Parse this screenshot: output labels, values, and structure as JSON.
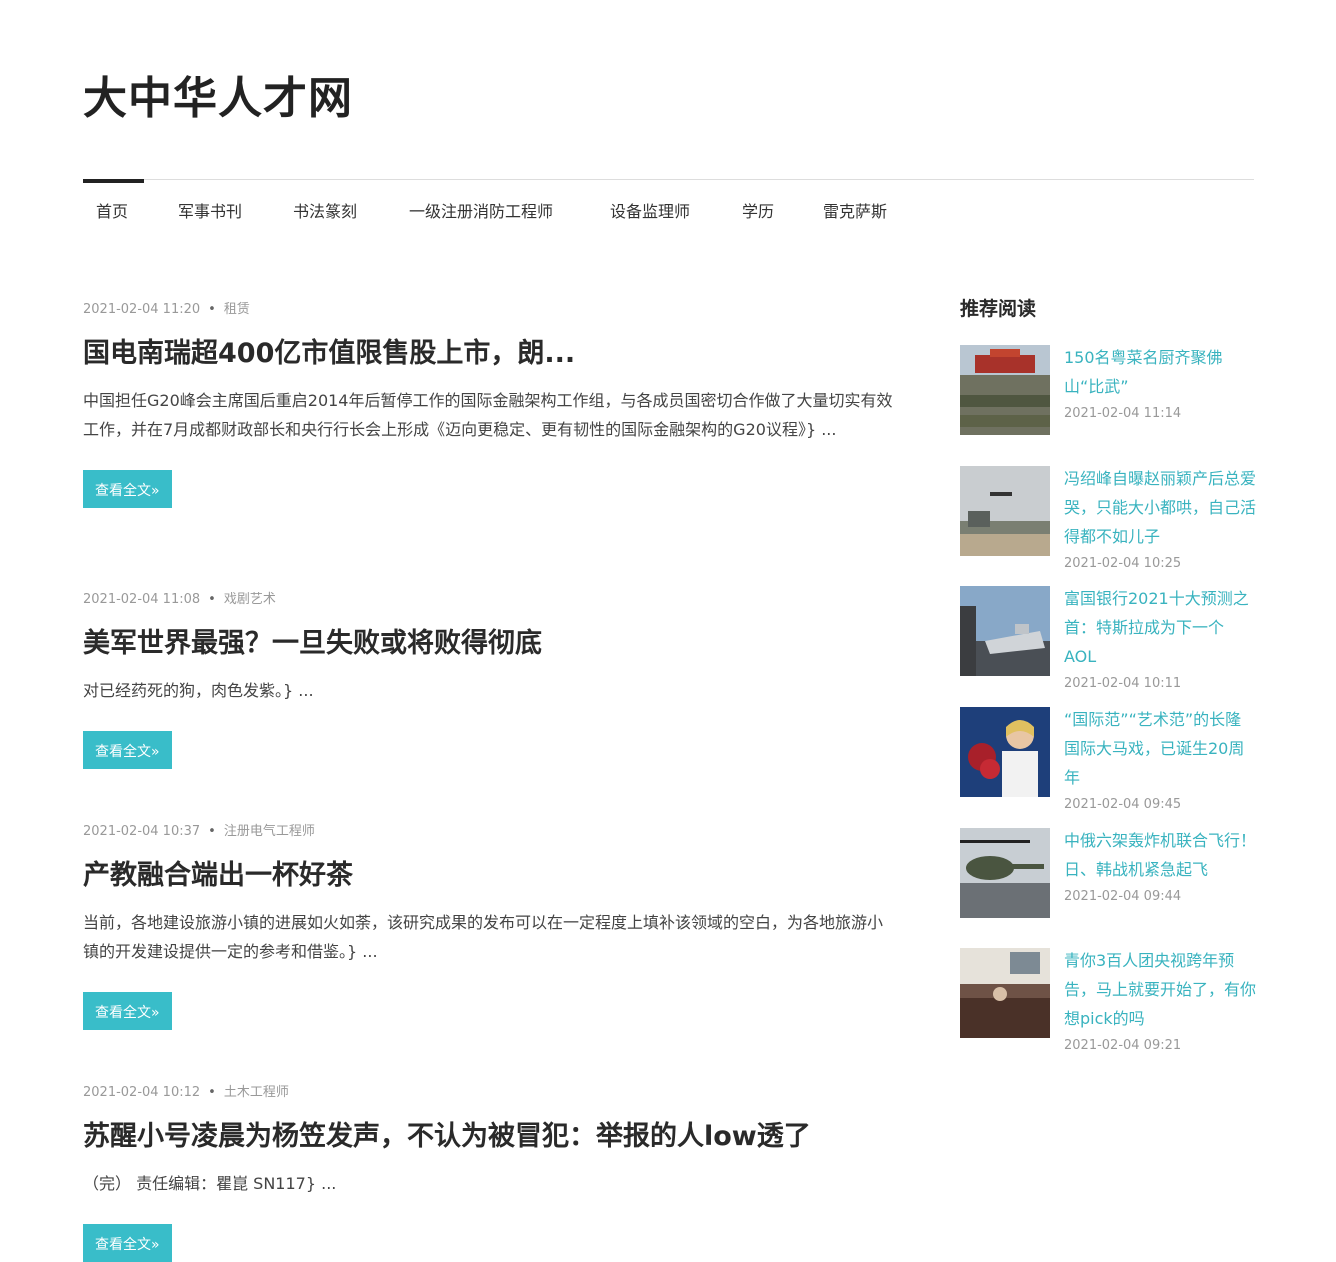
{
  "site": {
    "title": "大中华人才网"
  },
  "nav": {
    "items": [
      {
        "label": "首页"
      },
      {
        "label": "军事书刊"
      },
      {
        "label": "书法篆刻"
      },
      {
        "label": "一级注册消防工程师"
      },
      {
        "label": "设备监理师"
      },
      {
        "label": "学历"
      },
      {
        "label": "雷克萨斯"
      }
    ]
  },
  "posts": [
    {
      "date": "2021-02-04 11:20",
      "category": "租赁",
      "title": "国电南瑞超400亿市值限售股上市，朗...",
      "excerpt": "中国担任G20峰会主席国后重启2014年后暂停工作的国际金融架构工作组，与各成员国密切合作做了大量切实有效工作，并在7月成都财政部长和央行行长会上形成《迈向更稳定、更有韧性的国际金融架构的G20议程》} ...",
      "button": "查看全文»"
    },
    {
      "date": "2021-02-04 11:08",
      "category": "戏剧艺术",
      "title": "美军世界最强？一旦失败或将败得彻底",
      "excerpt": "对已经药死的狗，肉色发紫。} ...",
      "button": "查看全文»"
    },
    {
      "date": "2021-02-04 10:37",
      "category": "注册电气工程师",
      "title": "产教融合端出一杯好茶",
      "excerpt": "当前，各地建设旅游小镇的进展如火如荼，该研究成果的发布可以在一定程度上填补该领域的空白，为各地旅游小镇的开发建设提供一定的参考和借鉴。} ...",
      "button": "查看全文»"
    },
    {
      "date": "2021-02-04 10:12",
      "category": "土木工程师",
      "title": "苏醒小号凌晨为杨笠发声，不认为被冒犯：举报的人low透了",
      "excerpt": "（完） 责任编辑：瞿崑 SN117} ...",
      "button": "查看全文»"
    }
  ],
  "sidebar": {
    "title": "推荐阅读",
    "items": [
      {
        "title": "150名粤菜名厨齐聚佛山“比武”",
        "date": "2021-02-04 11:14",
        "thumb": "parade-image"
      },
      {
        "title": "冯绍峰自曝赵丽颖产后总爱哭，只能大小都哄，自己活得都不如儿子",
        "date": "2021-02-04 10:25",
        "thumb": "drone-image"
      },
      {
        "title": "富国银行2021十大预测之首：特斯拉成为下一个AOL",
        "date": "2021-02-04 10:11",
        "thumb": "warship-image"
      },
      {
        "title": "“国际范”“艺术范”的长隆国际大马戏，已诞生20周年",
        "date": "2021-02-04 09:45",
        "thumb": "woman-flowers-image"
      },
      {
        "title": "中俄六架轰炸机联合飞行！日、韩战机紧急起飞",
        "date": "2021-02-04 09:44",
        "thumb": "helicopter-image"
      },
      {
        "title": "青你3百人团央视跨年预告，马上就要开始了，有你想pick的吗",
        "date": "2021-02-04 09:21",
        "thumb": "room-image"
      }
    ]
  }
}
